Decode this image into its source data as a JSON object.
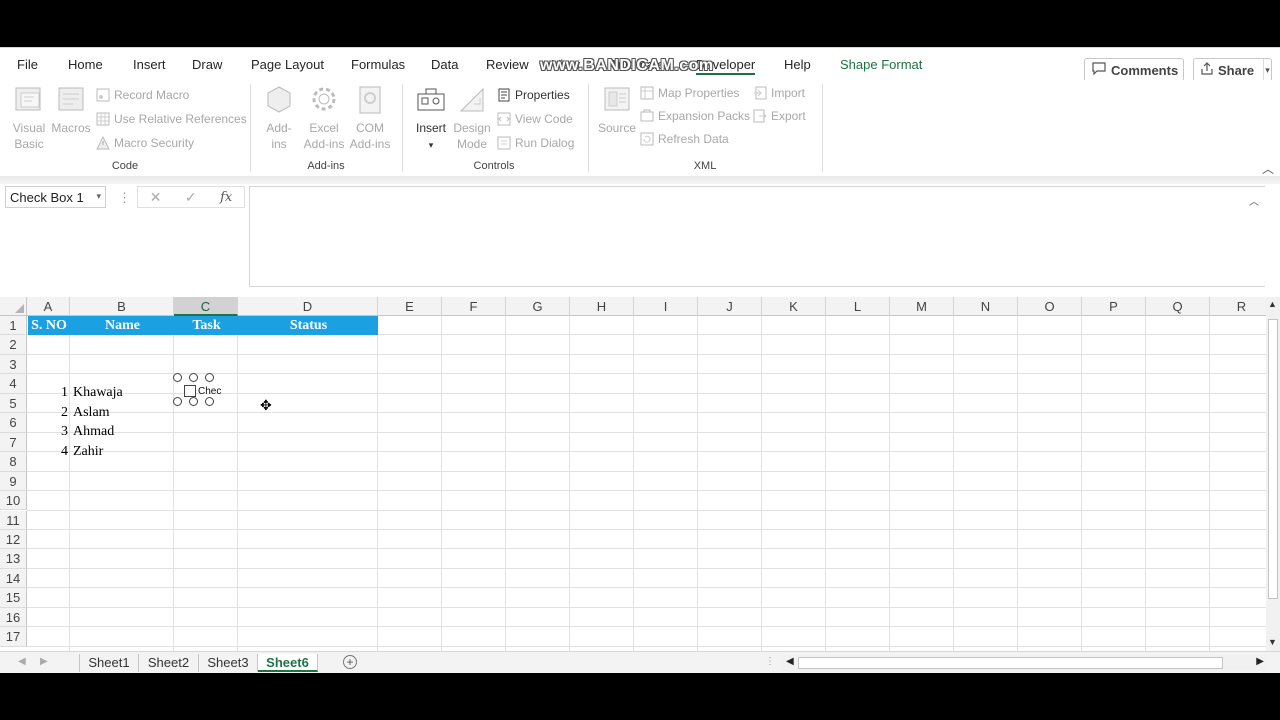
{
  "watermark": "www.BANDICAM.com",
  "tabs": {
    "file": "File",
    "home": "Home",
    "insert": "Insert",
    "draw": "Draw",
    "page_layout": "Page Layout",
    "formulas": "Formulas",
    "data": "Data",
    "review": "Review",
    "view": "View",
    "automate": "Automate",
    "developer": "Developer",
    "help": "Help",
    "shape_format": "Shape Format"
  },
  "top_buttons": {
    "comments": "Comments",
    "share": "Share"
  },
  "ribbon": {
    "code": {
      "label": "Code",
      "visual_basic": [
        "Visual",
        "Basic"
      ],
      "macros": "Macros",
      "record_macro": "Record Macro",
      "relative_refs": "Use Relative References",
      "macro_security": "Macro Security"
    },
    "addins": {
      "label": "Add-ins",
      "addins": [
        "Add-",
        "ins"
      ],
      "excel_addins": [
        "Excel",
        "Add-ins"
      ],
      "com_addins": [
        "COM",
        "Add-ins"
      ]
    },
    "controls": {
      "label": "Controls",
      "insert": "Insert",
      "design_mode": [
        "Design",
        "Mode"
      ],
      "properties": "Properties",
      "view_code": "View Code",
      "run_dialog": "Run Dialog"
    },
    "xml": {
      "label": "XML",
      "source": "Source",
      "map_properties": "Map Properties",
      "expansion_packs": "Expansion Packs",
      "refresh_data": "Refresh Data",
      "import": "Import",
      "export": "Export"
    }
  },
  "formula_bar": {
    "name_box": "Check Box 1",
    "fx": "fx",
    "cancel": "✕",
    "enter": "✓",
    "value": ""
  },
  "columns": [
    "A",
    "B",
    "C",
    "D",
    "E",
    "F",
    "G",
    "H",
    "I",
    "J",
    "K",
    "L",
    "M",
    "N",
    "O",
    "P",
    "Q",
    "R"
  ],
  "rows": [
    "1",
    "2",
    "3",
    "4",
    "5",
    "6",
    "7",
    "8",
    "9",
    "10",
    "11",
    "12",
    "13",
    "14",
    "15",
    "16",
    "17"
  ],
  "table": {
    "headers": [
      "S. NO",
      "Name",
      "Task",
      "Status"
    ],
    "data": [
      {
        "sno": "1",
        "name": "Khawaja"
      },
      {
        "sno": "2",
        "name": "Aslam"
      },
      {
        "sno": "3",
        "name": "Ahmad"
      },
      {
        "sno": "4",
        "name": "Zahir"
      }
    ]
  },
  "checkbox": {
    "label": "Chec",
    "checked": false
  },
  "sheets": [
    "Sheet1",
    "Sheet2",
    "Sheet3",
    "Sheet6"
  ],
  "active_sheet": "Sheet6",
  "colors": {
    "accent": "#217346",
    "header_band": "#1ba1e2"
  }
}
